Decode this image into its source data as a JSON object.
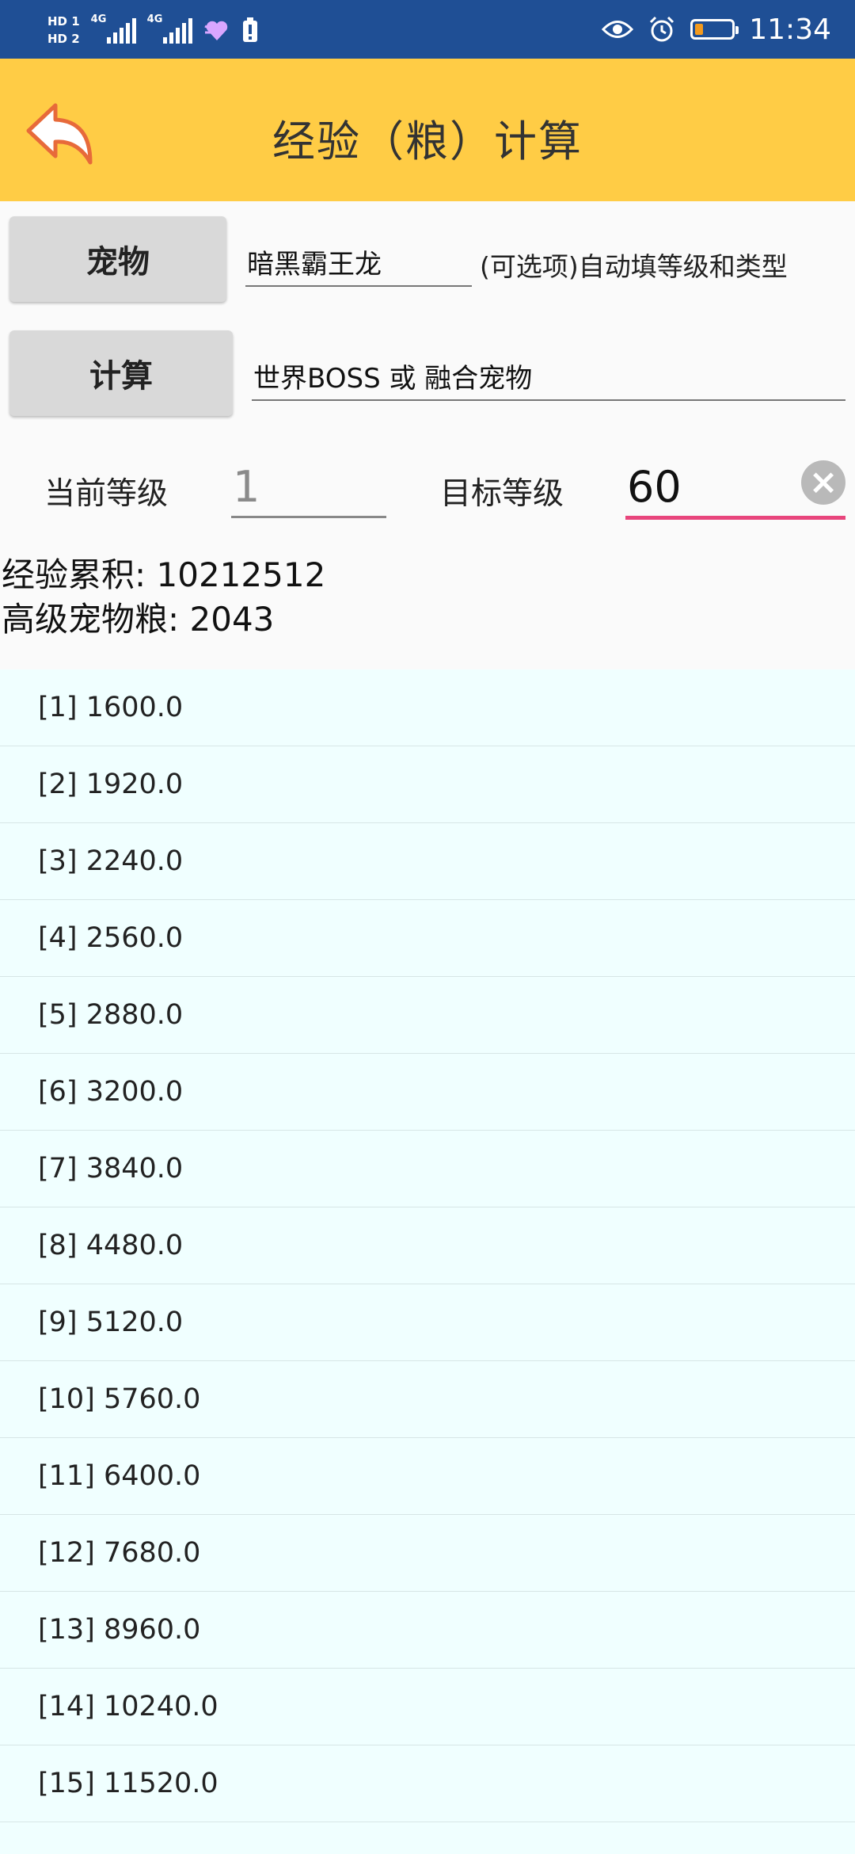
{
  "status_bar": {
    "hd1": "HD 1",
    "hd2": "HD 2",
    "net1": "4G",
    "net2": "4G",
    "time": "11:34",
    "icons": [
      "eye-icon",
      "alarm-icon",
      "battery-icon"
    ],
    "battery_level_fraction": 0.15,
    "battery_color": "#f39a1e"
  },
  "header": {
    "title": "经验（粮）计算",
    "background": "#ffcc45"
  },
  "form": {
    "pet_button": "宠物",
    "pet_value": "暗黑霸王龙",
    "pet_hint": "(可选项)自动填等级和类型",
    "calc_button": "计算",
    "type_value": "世界BOSS 或 融合宠物",
    "current_level_label": "当前等级",
    "current_level_placeholder": "1",
    "target_level_label": "目标等级",
    "target_level_value": "60",
    "accent": "#e8457c"
  },
  "results": {
    "exp_total_label": "经验累积:",
    "exp_total_value": "10212512",
    "food_label": "高级宠物粮:",
    "food_value": "2043"
  },
  "level_list": [
    "[1] 1600.0",
    "[2] 1920.0",
    "[3] 2240.0",
    "[4] 2560.0",
    "[5] 2880.0",
    "[6] 3200.0",
    "[7] 3840.0",
    "[8] 4480.0",
    "[9] 5120.0",
    "[10] 5760.0",
    "[11] 6400.0",
    "[12] 7680.0",
    "[13] 8960.0",
    "[14] 10240.0",
    "[15] 11520.0"
  ]
}
